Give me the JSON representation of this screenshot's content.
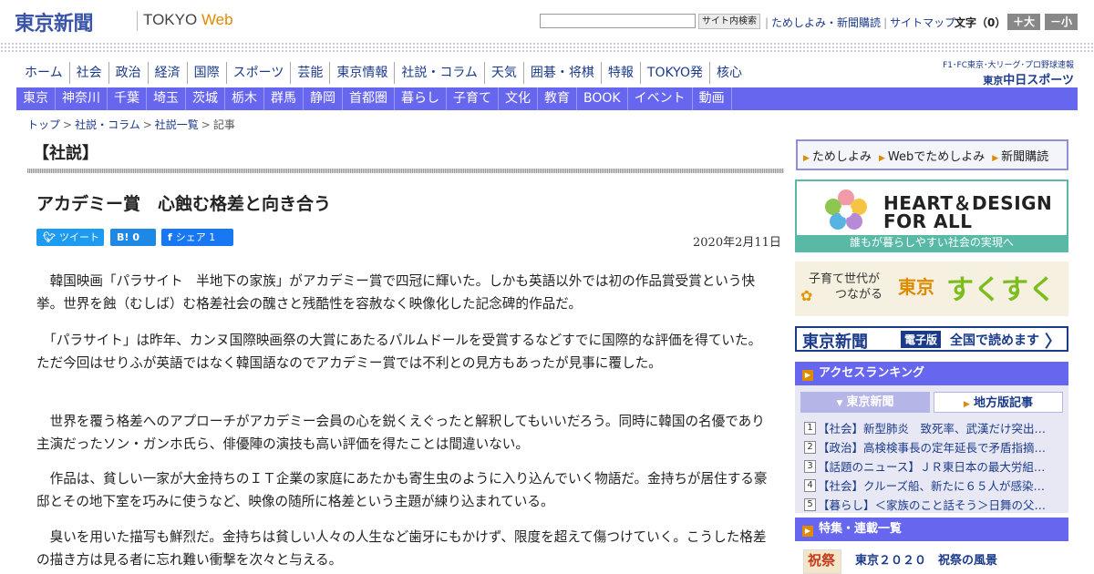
{
  "header": {
    "logo_jp": "東京新聞",
    "logo_en_prefix": "TOKYO",
    "logo_en_suffix": "Web",
    "search_button": "サイト内検索",
    "links": [
      "ためしよみ・新聞購読",
      "サイトマップ"
    ],
    "font_size_label": "文字（0）",
    "font_bigger": "＋大",
    "font_smaller": "－小"
  },
  "nav_primary": [
    "ホーム",
    "社会",
    "政治",
    "経済",
    "国際",
    "スポーツ",
    "芸能",
    "東京情報",
    "社説・コラム",
    "天気",
    "囲碁・将棋",
    "特報",
    "TOKYO発",
    "核心"
  ],
  "chunichi": {
    "line1": "F1･FC東京･大リーグ･プロ野球速報",
    "line2_prefix": "東京",
    "line2_main": "中日スポーツ"
  },
  "nav_secondary": [
    "東京",
    "神奈川",
    "千葉",
    "埼玉",
    "茨城",
    "栃木",
    "群馬",
    "静岡",
    "首都圏",
    "暮らし",
    "子育て",
    "文化",
    "教育",
    "BOOK",
    "イベント",
    "動画"
  ],
  "breadcrumb": [
    "トップ",
    "社説・コラム",
    "社説一覧",
    "記事"
  ],
  "article": {
    "section": "【社説】",
    "title": "アカデミー賞　心蝕む格差と向き合う",
    "date": "2020年2月11日",
    "share": {
      "tweet": "ツイート",
      "hatena_icon": "B!",
      "hatena_count": "0",
      "fb_label": "シェア",
      "fb_count": "1"
    },
    "paragraphs": [
      "　韓国映画「パラサイト　半地下の家族」がアカデミー賞で四冠に輝いた。しかも英語以外では初の作品賞受賞という快挙。世界を蝕（むしば）む格差社会の醜さと残酷性を容赦なく映像化した記念碑的作品だ。",
      "　「パラサイト」は昨年、カンヌ国際映画祭の大賞にあたるパルムドールを受賞するなどすでに国際的な評価を得ていた。ただ今回はせりふが英語ではなく韓国語なのでアカデミー賞では不利との見方もあったが見事に覆した。",
      "　世界を覆う格差へのアプローチがアカデミー会員の心を鋭くえぐったと解釈してもいいだろう。同時に韓国の名優であり主演だったソン・ガンホ氏ら、俳優陣の演技も高い評価を得たことは間違いない。",
      "　作品は、貧しい一家が大金持ちのＩＴ企業の家庭にあたかも寄生虫のように入り込んでいく物語だ。金持ちが居住する豪邸とその地下室を巧みに使うなど、映像の随所に格差という主題が練り込まれている。",
      "　臭いを用いた描写も鮮烈だ。金持ちは貧しい人々の人生など歯牙にもかけず、限度を超えて傷つけていく。こうした格差の描き方は見る者に忘れ難い衝撃を次々と与える。"
    ]
  },
  "sidebar": {
    "quick_links": [
      "ためしよみ",
      "Webでためしよみ",
      "新聞購読"
    ],
    "heart_design": {
      "line1": "HEART＆DESIGN",
      "line2": "FOR ALL",
      "footer": "誰もが暮らしやすい社会の実現へ"
    },
    "sukusuku": {
      "sub1": "子育て世代が",
      "sub2": "つながる",
      "tokyo": "東京",
      "main": "すくすく"
    },
    "denshi": {
      "logo": "東京新聞",
      "tag": "電子版",
      "text": "全国で読めます",
      "chevron": "〉"
    },
    "ranking": {
      "heading": "アクセスランキング",
      "tab_active": "東京新聞",
      "tab_inactive": "地方版記事",
      "items": [
        {
          "num": "1",
          "text": "【社会】新型肺炎　致死率、武漢だけ突出…"
        },
        {
          "num": "2",
          "text": "【政治】高検検事長の定年延長で矛盾指摘…"
        },
        {
          "num": "3",
          "text": "【話題のニュース】ＪＲ東日本の最大労組…"
        },
        {
          "num": "4",
          "text": "【社会】クルーズ船、新たに６５人が感染…"
        },
        {
          "num": "5",
          "text": "【暮らし】＜家族のこと話そう＞日舞の父…"
        }
      ]
    },
    "feature": {
      "heading": "特集・連載一覧",
      "thumb_text": "祝祭",
      "title": "東京２０２０　祝祭の風景"
    }
  },
  "colors": {
    "brand_blue": "#3a55a8",
    "nav_blue": "#6666ee",
    "accent_orange": "#e08a00",
    "link": "#1a3a8a",
    "hd_teal": "#59b9a7"
  }
}
